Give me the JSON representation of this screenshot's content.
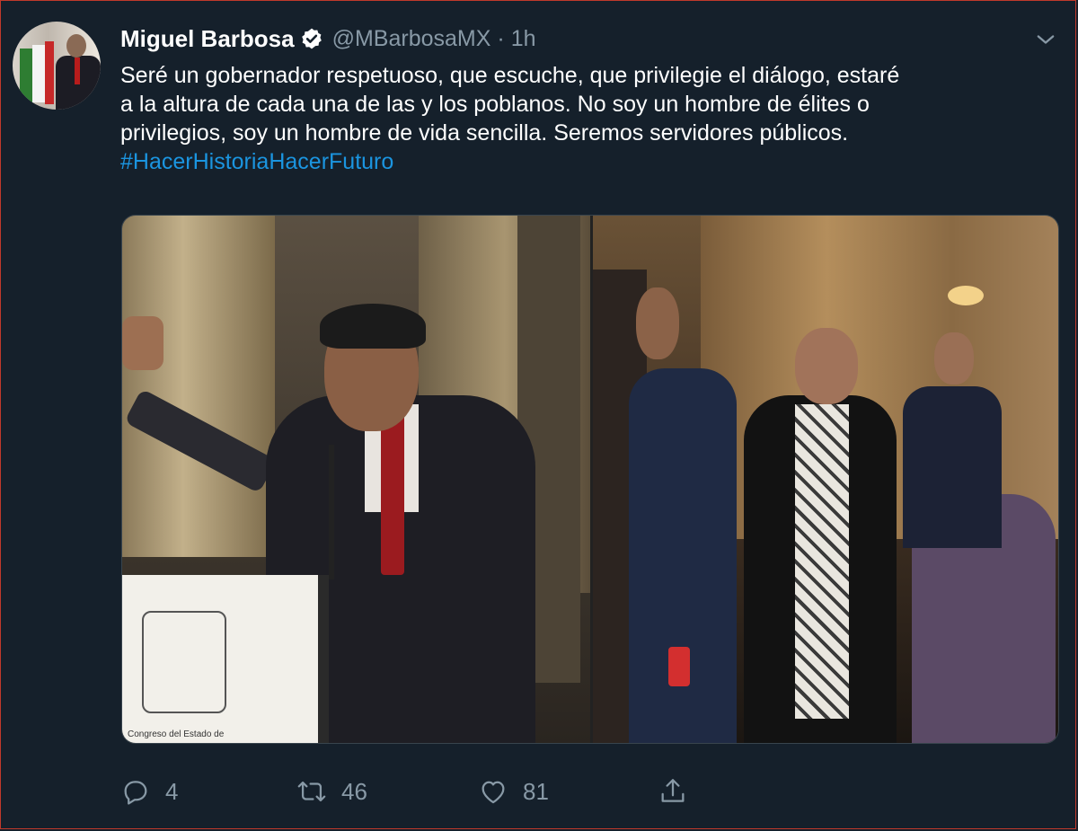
{
  "tweet": {
    "author_name": "Miguel Barbosa",
    "author_handle": "@MBarbosaMX",
    "separator": "·",
    "time": "1h",
    "text_lines": [
      "Seré un gobernador respetuoso, que escuche, que privilegie el diálogo, estaré",
      "a la altura de cada una de las y los poblanos. No soy un hombre de élites o",
      "privilegios, soy un hombre de vida sencilla. Seremos servidores públicos."
    ],
    "hashtag": "#HacerHistoriaHacerFuturo",
    "podium_seal_text": "Congreso del Estado de"
  },
  "actions": {
    "reply_count": "4",
    "retweet_count": "46",
    "like_count": "81"
  },
  "icons": {
    "verified": "verified-badge-icon",
    "menu": "chevron-down-icon",
    "reply": "reply-icon",
    "retweet": "retweet-icon",
    "like": "heart-icon",
    "share": "share-icon"
  },
  "colors": {
    "background": "#15202b",
    "text": "#ffffff",
    "secondary": "#8899a6",
    "link": "#1b95e0"
  }
}
